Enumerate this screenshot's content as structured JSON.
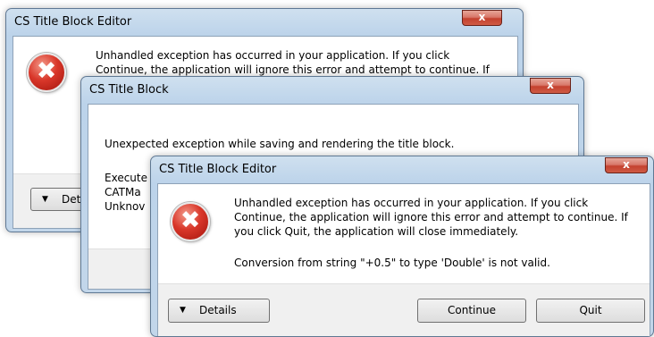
{
  "dialog_back": {
    "title": "CS Title Block Editor",
    "close_glyph": "x",
    "message_line1": "Unhandled exception has occurred in your application. If you click",
    "message_line2": "Continue, the application will ignore this error and attempt to continue. If",
    "details_label": "Deta",
    "icon": "error-icon"
  },
  "dialog_middle": {
    "title": "CS Title Block",
    "close_glyph": "x",
    "message": "Unexpected exception while saving and rendering the title block.",
    "detail_lines": [
      "Execute",
      "CATMa",
      "Unknov"
    ]
  },
  "dialog_front": {
    "title": "CS Title Block Editor",
    "close_glyph": "x",
    "message_lines": [
      "Unhandled exception has occurred in your application. If you click",
      "Continue, the application will ignore this error and attempt to continue. If",
      "you click Quit, the application will close immediately."
    ],
    "conversion_message": "Conversion from string \"+0.5\" to type 'Double' is not valid.",
    "details_label": "Details",
    "continue_label": "Continue",
    "quit_label": "Quit",
    "icon": "error-icon"
  },
  "glyphs": {
    "x_mark": "✖",
    "down_arrow": "▼"
  }
}
